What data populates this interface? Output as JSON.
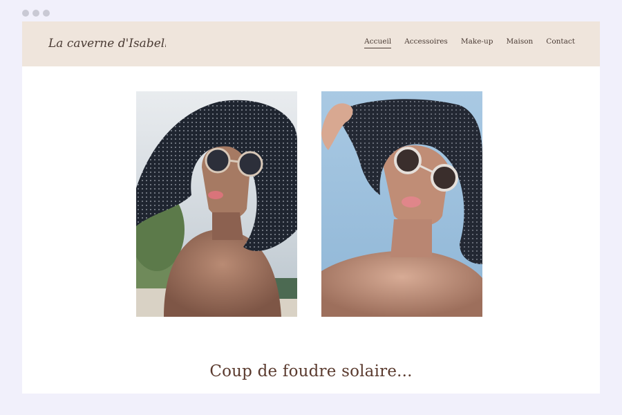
{
  "site": {
    "logo_text": "La caverne d'Isabella"
  },
  "nav": {
    "items": [
      {
        "label": "Accueil",
        "active": true
      },
      {
        "label": "Accessoires",
        "active": false
      },
      {
        "label": "Make-up",
        "active": false
      },
      {
        "label": "Maison",
        "active": false
      },
      {
        "label": "Contact",
        "active": false
      }
    ]
  },
  "main": {
    "headline": "Coup de foudre solaire..."
  },
  "colors": {
    "page_bg": "#f1f0fb",
    "header_bg": "#efe5dc",
    "text": "#4a3b34",
    "headline": "#5a3a2e"
  }
}
